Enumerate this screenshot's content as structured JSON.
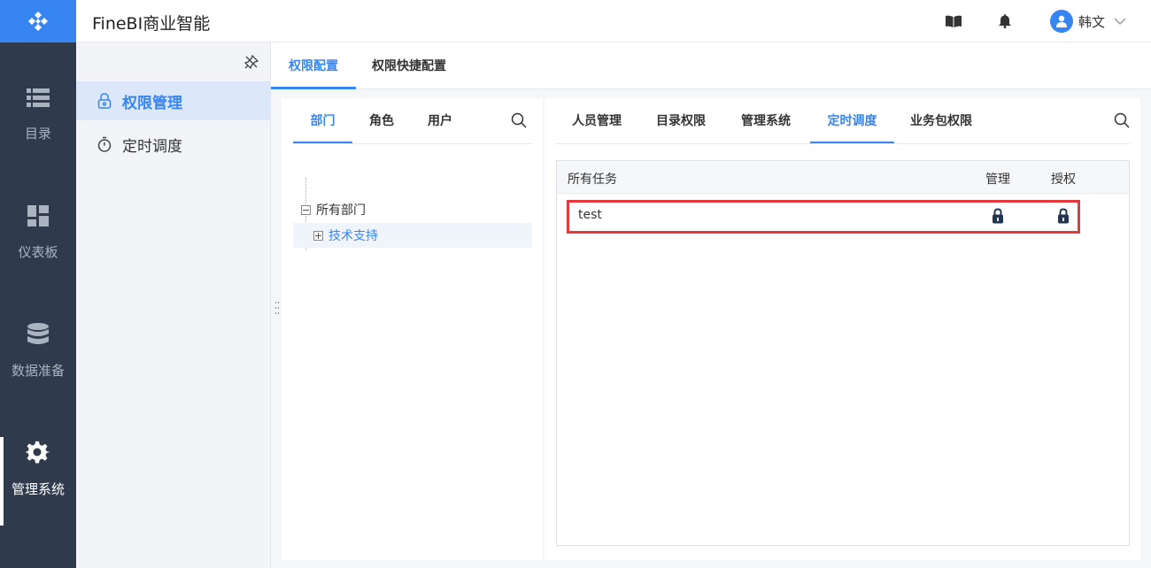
{
  "app": {
    "title": "FineBI商业智能"
  },
  "nav": {
    "items": [
      {
        "label": "目录",
        "icon": "list-icon"
      },
      {
        "label": "仪表板",
        "icon": "dashboard-icon"
      },
      {
        "label": "数据准备",
        "icon": "database-icon"
      },
      {
        "label": "管理系统",
        "icon": "gear-icon",
        "active": true
      }
    ]
  },
  "header": {
    "user_name": "韩文",
    "icons": [
      "book-icon",
      "bell-icon"
    ]
  },
  "sidebar": {
    "items": [
      {
        "label": "权限管理",
        "icon": "lock-icon",
        "active": true
      },
      {
        "label": "定时调度",
        "icon": "timer-icon"
      }
    ]
  },
  "main_tabs": {
    "items": [
      "权限配置",
      "权限快捷配置"
    ],
    "active": "权限配置"
  },
  "left_panel": {
    "tabs": [
      "部门",
      "角色",
      "用户"
    ],
    "active_tab": "部门",
    "tree": {
      "root": "所有部门",
      "child": "技术支持"
    }
  },
  "right_panel": {
    "tabs": [
      "人员管理",
      "目录权限",
      "管理系统",
      "定时调度",
      "业务包权限"
    ],
    "active_tab": "定时调度",
    "table": {
      "columns": [
        "所有任务",
        "管理",
        "授权"
      ],
      "rows": [
        {
          "name": "test",
          "manage": "locked",
          "grant": "locked"
        }
      ]
    }
  },
  "colors": {
    "accent": "#3685f2",
    "nav_bg": "#2f3b4d",
    "highlight": "#e5383b"
  }
}
